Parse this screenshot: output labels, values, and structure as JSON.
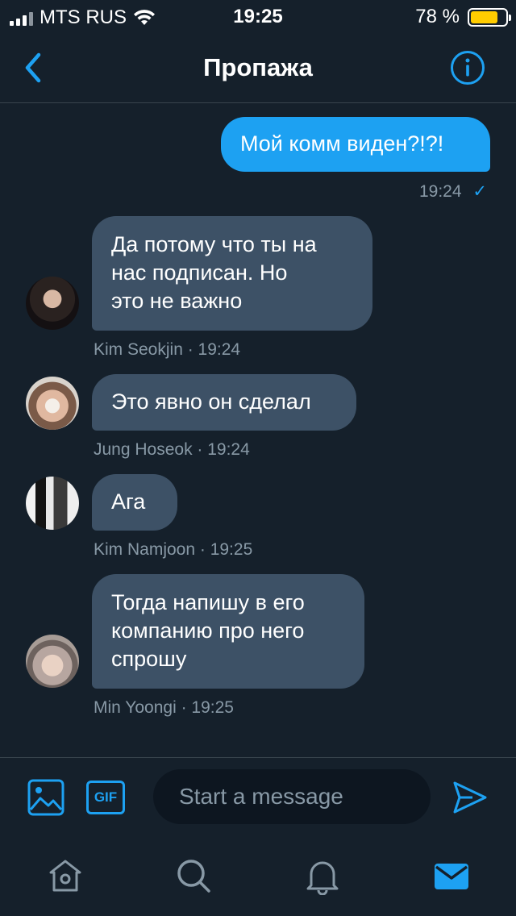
{
  "status_bar": {
    "carrier": "MTS RUS",
    "time": "19:25",
    "battery": "78 %",
    "battery_level": 0.78,
    "battery_color": "#ffcc00"
  },
  "header": {
    "title": "Пропажа",
    "back_icon": "chevron-left-icon",
    "info_icon": "info-icon"
  },
  "messages": [
    {
      "direction": "outgoing",
      "text": "Мой комм виден?!?!",
      "time": "19:24",
      "status": "✓"
    },
    {
      "direction": "incoming",
      "lines": [
        "Да потому что ты на",
        "нас подписан. Но",
        "это не важно"
      ],
      "sender": "Kim Seokjin · 19:24"
    },
    {
      "direction": "incoming",
      "text": "Это явно он сделал",
      "sender": "Jung Hoseok · 19:24"
    },
    {
      "direction": "incoming",
      "text": "Ага",
      "sender": "Kim Namjoon · 19:25"
    },
    {
      "direction": "incoming",
      "lines": [
        "Тогда напишу в его",
        "компанию про него",
        "спрошу"
      ],
      "sender": "Min Yoongi · 19:25"
    }
  ],
  "composer": {
    "placeholder": "Start a message",
    "gif_label": "GIF"
  },
  "colors": {
    "background": "#15202b",
    "accent": "#1da1f2",
    "incoming_bubble": "#3d5166",
    "secondary_text": "#8899a6"
  },
  "tabs": [
    "home-icon",
    "search-icon",
    "bell-icon",
    "mail-icon"
  ]
}
